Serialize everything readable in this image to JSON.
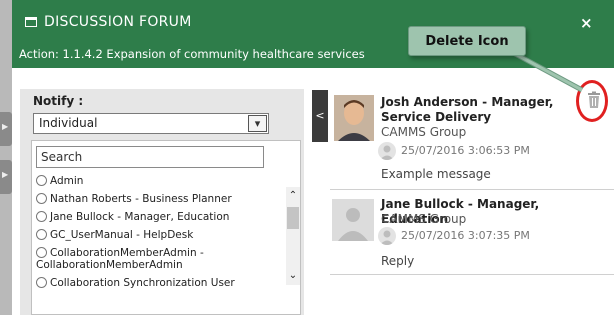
{
  "modal": {
    "title": "DISCUSSION FORUM",
    "close_label": "×",
    "action_text": "Action: 1.1.4.2 Expansion of community healthcare services"
  },
  "notify": {
    "label": "Notify :",
    "selected": "Individual",
    "search_placeholder": "Search",
    "members": [
      "Admin",
      "Nathan Roberts - Business Planner",
      "Jane Bullock - Manager, Education",
      "GC_UserManual - HelpDesk",
      "CollaborationMemberAdmin - CollaborationMemberAdmin",
      "Collaboration Synchronization User"
    ]
  },
  "toggle_label": "<",
  "posts": [
    {
      "author": "Josh Anderson - Manager, Service Delivery",
      "org": "CAMMS Group",
      "timestamp": "25/07/2016 3:06:53 PM",
      "message": "Example message"
    },
    {
      "author": "Jane Bullock - Manager, Education",
      "org": "CAMMS Group",
      "timestamp": "25/07/2016 3:07:35 PM",
      "message": "Reply"
    }
  ],
  "callout_text": "Delete Icon",
  "colors": {
    "header": "#2e7d4a",
    "callout": "#9ec4ae",
    "highlight": "#e02020"
  }
}
